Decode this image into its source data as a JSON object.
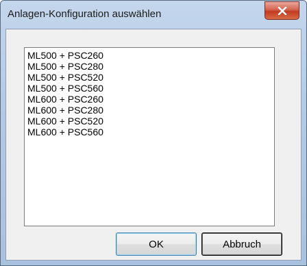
{
  "window": {
    "title": "Anlagen-Konfiguration auswählen"
  },
  "title_bar_controls": {
    "close_icon": "close-icon",
    "close_color": "#c9472e"
  },
  "listbox": {
    "items": [
      "ML500 + PSC260",
      "ML500 + PSC280",
      "ML500 + PSC520",
      "ML500 + PSC560",
      "ML600 + PSC260",
      "ML600 + PSC280",
      "ML600 + PSC520",
      "ML600 + PSC560"
    ]
  },
  "buttons": {
    "ok_label": "OK",
    "cancel_label": "Abbruch"
  }
}
